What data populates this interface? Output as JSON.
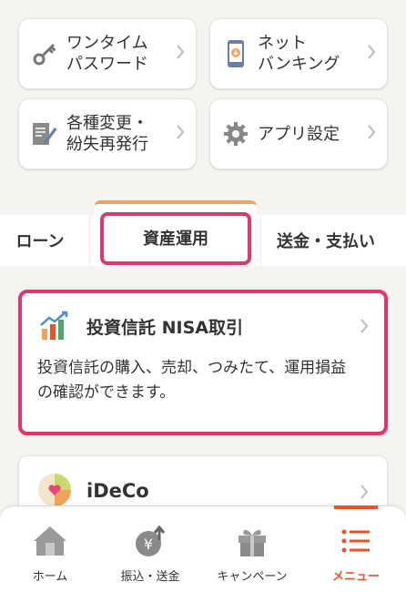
{
  "quick_menu": [
    {
      "label": "ワンタイム\nパスワード",
      "icon": "key-icon"
    },
    {
      "label": "ネット\nバンキング",
      "icon": "smartphone-icon"
    },
    {
      "label": "各種変更・\n紛失再発行",
      "icon": "document-pen-icon"
    },
    {
      "label": "アプリ設定",
      "icon": "gear-icon"
    }
  ],
  "tabs": [
    {
      "label": "ローン"
    },
    {
      "label": "資産運用",
      "active": true
    },
    {
      "label": "送金・支払い"
    }
  ],
  "investment_card": {
    "title": "投資信託 NISA取引",
    "description": "投資信託の購入、売却、つみたて、運用損益の確認ができます。"
  },
  "ideco_card": {
    "title": "iDeCo"
  },
  "bottom_nav": [
    {
      "label": "ホーム",
      "icon": "house-icon"
    },
    {
      "label": "振込・送金",
      "icon": "yen-coin-icon"
    },
    {
      "label": "キャンペーン",
      "icon": "gift-icon"
    },
    {
      "label": "メニュー",
      "icon": "menu-list-icon",
      "active": true
    }
  ],
  "colors": {
    "accent": "#e8542a",
    "highlight": "#e3356a",
    "tab_accent": "#f0a35a",
    "background": "#f6f4f1"
  }
}
